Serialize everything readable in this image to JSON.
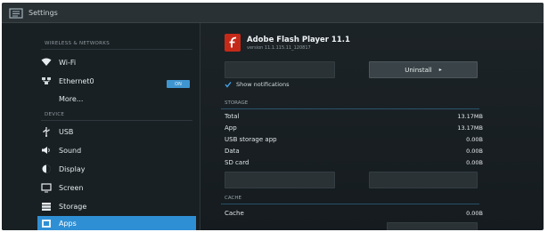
{
  "window": {
    "title": "Settings"
  },
  "sidebar": {
    "sections": [
      {
        "label": "WIRELESS & NETWORKS"
      },
      {
        "label": "DEVICE"
      }
    ],
    "wifi_toggle": "ON",
    "items": [
      {
        "label": "Wi-Fi",
        "icon": "wifi-icon"
      },
      {
        "label": "Ethernet0",
        "icon": "ethernet-icon"
      },
      {
        "label": "More...",
        "icon": ""
      },
      {
        "label": "USB",
        "icon": "usb-icon"
      },
      {
        "label": "Sound",
        "icon": "speaker-icon"
      },
      {
        "label": "Display",
        "icon": "brightness-icon"
      },
      {
        "label": "Screen",
        "icon": "screen-icon"
      },
      {
        "label": "Storage",
        "icon": "storage-icon"
      },
      {
        "label": "Apps",
        "icon": "android-icon",
        "active": true
      }
    ]
  },
  "detail": {
    "app_name": "Adobe Flash Player 11.1",
    "app_version": "version 11.1.115.11_120817",
    "uninstall_label": "Uninstall",
    "show_notifications": "Show notifications",
    "storage": {
      "header": "STORAGE",
      "rows": [
        {
          "label": "Total",
          "value": "13.17MB"
        },
        {
          "label": "App",
          "value": "13.17MB"
        },
        {
          "label": "USB storage app",
          "value": "0.00B"
        },
        {
          "label": "Data",
          "value": "0.00B"
        },
        {
          "label": "SD card",
          "value": "0.00B"
        }
      ]
    },
    "cache": {
      "header": "CACHE",
      "rows": [
        {
          "label": "Cache",
          "value": "0.00B"
        }
      ]
    }
  },
  "colors": {
    "accent": "#2f8fd4",
    "background": "#1a2125",
    "flash": "#c52a19"
  }
}
